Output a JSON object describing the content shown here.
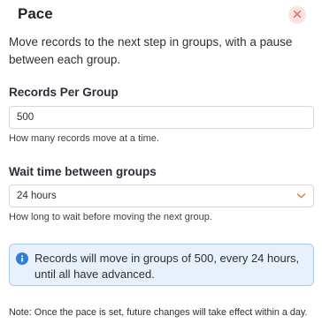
{
  "dialog": {
    "title": "Pace",
    "description": "Move records to the next step in groups, with a pause between each group.",
    "close_icon": "close-x-icon"
  },
  "records_per_group": {
    "label": "Records Per Group",
    "value": "500",
    "help": "How many records move at a time."
  },
  "wait_time": {
    "label": "Wait time between groups",
    "selected": "24 hours",
    "help": "How long to wait before moving the next group.",
    "icon": "chevron-down-icon"
  },
  "info_box": {
    "icon": "info-icon",
    "text": "Records will move in groups of 500, every 24 hours, until all have advanced."
  },
  "note": "Note: Once the pace is set, future changes will take effect within a day.",
  "colors": {
    "close_bg": "#fbe3e3",
    "close_x": "#e0615f",
    "info_bg": "#e8f1fb",
    "info_border": "#a9c8ec",
    "info_icon": "#2f7fd9",
    "chevron": "#e07b39"
  }
}
